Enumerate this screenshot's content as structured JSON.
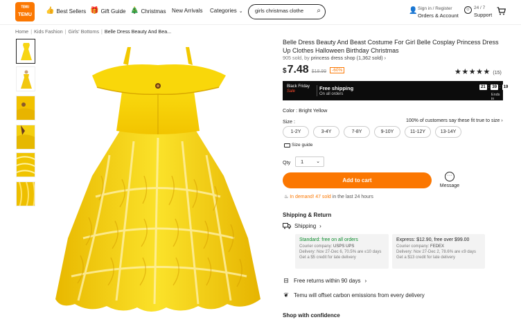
{
  "header": {
    "logo_line1": "ᵀᴱᴹᵁ",
    "logo_line2": "TEMU",
    "nav": [
      {
        "label": "Best Sellers",
        "icon": "thumbs-up-icon"
      },
      {
        "label": "Gift Guide",
        "icon": "gift-icon"
      },
      {
        "label": "Christmas",
        "icon": "christmas-tree-icon"
      },
      {
        "label": "New Arrivals",
        "icon": ""
      },
      {
        "label": "Categories",
        "icon": "chevron-down-icon"
      }
    ],
    "search_value": "girls christmas clothe",
    "account_line1": "Sign in / Register",
    "account_line2": "Orders & Account",
    "support_line1": "24 / 7",
    "support_line2": "Support"
  },
  "breadcrumb": [
    "Home",
    "Kids Fashion",
    "Girls' Bottoms",
    "Belle Dress Beauty And Bea..."
  ],
  "product": {
    "title": "Belle Dress Beauty And Beast Costume For Girl Belle Cosplay Princess Dress Up Clothes Halloween Birthday Christmas",
    "sold_prefix": "905 sold, by",
    "shop": "princess dress shop (1,362 sold)",
    "currency": "$",
    "price": "7.48",
    "orig_price": "$18.99",
    "discount": "-60%",
    "rating": 5,
    "review_count": "(15)"
  },
  "promo": {
    "event_line1": "Black Friday",
    "event_line2": "Sale",
    "shipping_title": "Free shipping",
    "shipping_sub": "On all orders",
    "timer": [
      "21",
      "39",
      "19"
    ],
    "ends_label": "Ends in"
  },
  "options": {
    "color_label": "Color : Bright Yellow",
    "size_label": "Size :",
    "fit_text": "100% of customers say these fit true to size",
    "sizes": [
      "1-2Y",
      "3-4Y",
      "7-8Y",
      "9-10Y",
      "11-12Y",
      "13-14Y"
    ],
    "size_guide": "Size guide",
    "qty_label": "Qty",
    "qty_value": "1"
  },
  "actions": {
    "add_to_cart": "Add to cart",
    "message": "Message"
  },
  "demand": {
    "highlight": "In demand! 47 sold",
    "rest": " in the last 24 hours"
  },
  "shipping": {
    "heading": "Shipping & Return",
    "sub": "Shipping",
    "standard": {
      "title": "Standard: free on all orders",
      "courier": "Courier company:",
      "courier_names": "USPS  UPS",
      "delivery": "Delivery: Nov 27-Dec 6, 70.5% are ≤10 days",
      "credit": "Get a $5 credit for late delivery"
    },
    "express": {
      "title": "Express: $12.90, free over $99.00",
      "courier": "Courier company:",
      "courier_names": "FEDEX",
      "delivery": "Delivery: Nov 27-Dec 2, 78.6% are ≤9 days",
      "credit": "Get a $13 credit for late delivery"
    }
  },
  "features": {
    "returns": "Free returns within 90 days",
    "carbon": "Temu will offset carbon emissions from every delivery",
    "confidence": "Shop with confidence"
  },
  "colors": {
    "accent": "#fb7701",
    "dress_yellow": "#f7d513",
    "green": "#0a8a2b"
  }
}
